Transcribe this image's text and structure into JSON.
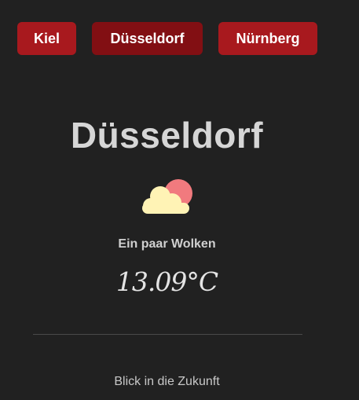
{
  "cities": {
    "kiel": "Kiel",
    "duesseldorf": "Düsseldorf",
    "nuernberg": "Nürnberg",
    "active": "Düsseldorf"
  },
  "weather": {
    "city": "Düsseldorf",
    "icon": "cloud-sun-icon",
    "description": "Ein paar Wolken",
    "temperature": "13.09°C"
  },
  "footer": {
    "forecast_link": "Blick in die Zukunft"
  },
  "colors": {
    "background": "#212121",
    "button": "#a8191e",
    "button_active": "#820f13",
    "sun": "#f17a7e",
    "cloud": "#fff3b5"
  }
}
